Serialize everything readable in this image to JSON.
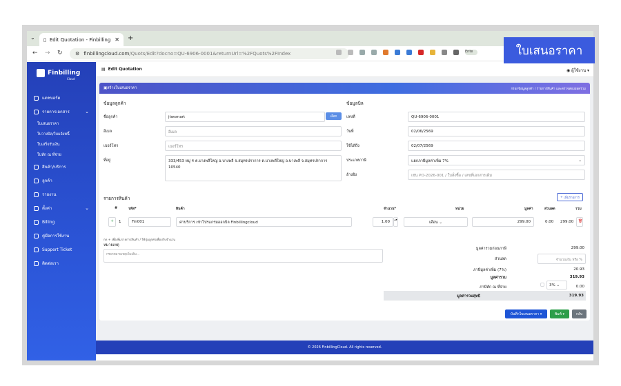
{
  "browser": {
    "tab_title": "Edit Quotation - Finbilling",
    "url_host": "finbillingcloud.com",
    "url_path": "/Quots/Edit?docno=QU-6906-0001&returnUrl=%2FQuots%2FIndex",
    "profile_label": "Ente"
  },
  "overlay_label": "ใบเสนอราคา",
  "app": {
    "logo_text": "Finbilling",
    "logo_sub": "Cloud",
    "page_title": "Edit Quotation",
    "user_label": "ผู้ใช้งาน"
  },
  "sidebar": {
    "items": [
      {
        "label": "แดชบอร์ด"
      },
      {
        "label": "รายการเอกสาร"
      },
      {
        "label": "ใบเสนอราคา"
      },
      {
        "label": "ใบวางบิล/ใบแจ้งหนี้"
      },
      {
        "label": "ใบเสร็จรับเงิน"
      },
      {
        "label": "ใบหัก ณ ที่จ่าย"
      },
      {
        "label": "สินค้า/บริการ"
      },
      {
        "label": "ลูกค้า"
      },
      {
        "label": "รายงาน"
      },
      {
        "label": "ตั้งค่า"
      },
      {
        "label": "Billing"
      },
      {
        "label": "คู่มือการใช้งาน"
      },
      {
        "label": "Support Ticket"
      },
      {
        "label": "ติดต่อเรา"
      }
    ]
  },
  "card": {
    "header": "สร้างใบเสนอราคา",
    "crumb": "กรอกข้อมูลลูกค้า / รายการสินค้า และตรวจสอบยอดรวม"
  },
  "customer": {
    "section": "ข้อมูลลูกค้า",
    "name_label": "ชื่อลูกค้า",
    "name_value": "jtwsmart",
    "select_button": "เลือก",
    "email_label": "อีเมล",
    "email_placeholder": "อีเมล",
    "phone_label": "เบอร์โทร",
    "phone_placeholder": "เบอร์โทร",
    "address_label": "ที่อยู่",
    "address_value": "333/453 หมู่ 4 ต.บางพลีใหญ่ อ.บางพลี จ.สมุทรปราการ ต.บางพลีใหญ่ อ.บางพลี จ.สมุทรปราการ 10540"
  },
  "billing": {
    "section": "ข้อมูลบิล",
    "docno_label": "เลขที่",
    "docno_value": "QU-6906-0001",
    "date_label": "วันที่",
    "date_value": "02/06/2569",
    "valid_label": "ใช้ได้ถึง",
    "valid_value": "02/07/2569",
    "tax_label": "ประเภทภาษี",
    "tax_value": "แยกภาษีมูลค่าเพิ่ม 7%",
    "ref_label": "อ้างอิง",
    "ref_placeholder": "เช่น PO-2026-001 / ใบสั่งซื้อ / เลขที่เอกสารเดิม"
  },
  "items": {
    "section": "รายการสินค้า",
    "add_button": "เพิ่มรายการ",
    "headers": {
      "no": "#",
      "code": "รหัส*",
      "name": "สินค้า",
      "qty": "จำนวน*",
      "unit": "หน่วย",
      "price": "มูลค่า",
      "discount": "ส่วนลด",
      "total": "รวม"
    },
    "rows": [
      {
        "no": "1",
        "code": "Fin001",
        "name": "ค่าบริการ เช่าโปรแกรมออกบิล Finbillingcloud",
        "qty": "1.00",
        "unit": "เดือน",
        "price": "299.00",
        "discount": "0.00",
        "total": "299.00"
      }
    ],
    "hint": "กด + เพื่อเพิ่มรายการสินค้า / ใช้ปุ่มลูกศรเพื่อปรับจำนวน"
  },
  "notes": {
    "label": "หมายเหตุ",
    "placeholder": "กรอกหมายเหตุเพิ่มเติม..."
  },
  "totals": {
    "subtotal_label": "มูลค่ารวมก่อนภาษี",
    "subtotal_value": "299.00",
    "discount_label": "ส่วนลด",
    "discount_placeholder": "จำนวนเงิน หรือ %",
    "vat_label": "ภาษีมูลค่าเพิ่ม (7%)",
    "vat_value": "20.93",
    "total_label": "มูลค่ารวม",
    "total_value": "319.93",
    "wht_label": "ภาษีหัก ณ ที่จ่าย",
    "wht_rate": "3%",
    "wht_value": "0.00",
    "grand_label": "มูลค่ารวมสุทธิ",
    "grand_value": "319.93"
  },
  "actions": {
    "save": "บันทึกใบเสนอราคา",
    "print": "พิมพ์",
    "back": "กลับ"
  },
  "footer": "© 2026 FinbillingCloud. All rights reserved.",
  "colors": {
    "primary": "#2440b8",
    "accent": "#3b5bde",
    "save": "#1e55d6",
    "print": "#2e9e4a",
    "back": "#6c757d"
  }
}
